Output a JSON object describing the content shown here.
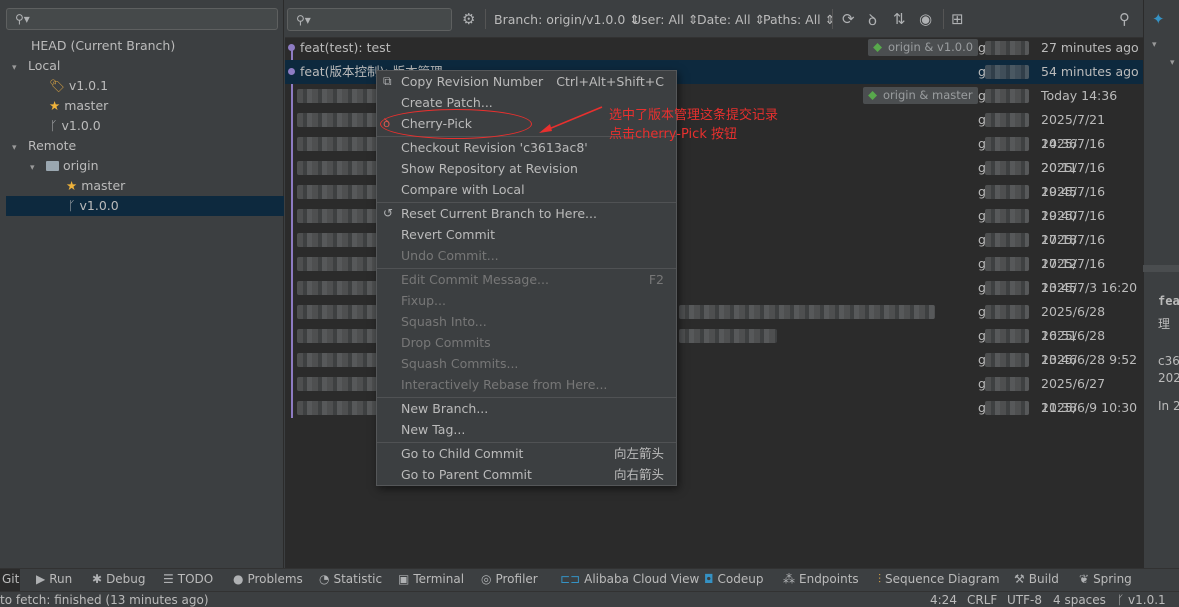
{
  "left": {
    "tree": [
      {
        "label": "HEAD (Current Branch)"
      },
      {
        "label": "Local"
      },
      {
        "label": "v1.0.1"
      },
      {
        "label": "master"
      },
      {
        "label": "v1.0.0"
      },
      {
        "label": "Remote"
      },
      {
        "label": "origin"
      },
      {
        "label": "master"
      },
      {
        "label": "v1.0.0"
      }
    ]
  },
  "toolbar": {
    "branch_filter": "Branch: origin/v1.0.0",
    "user_filter": "User: All",
    "date_filter": "Date: All",
    "paths_filter": "Paths: All"
  },
  "log": {
    "rows": [
      {
        "subject": "feat(test): test",
        "refs": "origin & v1.0.0",
        "author": "g",
        "date": "27 minutes ago"
      },
      {
        "subject": "feat(版本控制): 版本管理",
        "refs": "",
        "author": "g",
        "date": "54 minutes ago"
      },
      {
        "subject": "",
        "refs": "origin & master",
        "author": "g",
        "date": "Today 14:36"
      },
      {
        "subject": "",
        "refs": "",
        "author": "g",
        "date": "2025/7/21 14:36"
      },
      {
        "subject": "",
        "refs": "",
        "author": "g",
        "date": "2025/7/16 20:11"
      },
      {
        "subject": "",
        "refs": "",
        "author": "g",
        "date": "2025/7/16 19:45"
      },
      {
        "subject": "",
        "refs": "",
        "author": "g",
        "date": "2025/7/16 19:40"
      },
      {
        "subject": "",
        "refs": "",
        "author": "g",
        "date": "2025/7/16 17:18"
      },
      {
        "subject": "",
        "refs": "",
        "author": "g",
        "date": "2025/7/16 17:12"
      },
      {
        "subject": "",
        "refs": "",
        "author": "g",
        "date": "2025/7/16 13:45"
      },
      {
        "subject": "",
        "refs": "",
        "author": "g",
        "date": "2025/7/3 16:20"
      },
      {
        "subject": "",
        "refs": "",
        "author": "g",
        "date": "2025/6/28 16:51"
      },
      {
        "subject": "",
        "refs": "",
        "author": "g",
        "date": "2025/6/28 13:46"
      },
      {
        "subject": "",
        "refs": "",
        "author": "g",
        "date": "2025/6/28 9:52"
      },
      {
        "subject": "",
        "refs": "",
        "author": "g",
        "date": "2025/6/27 11:38"
      },
      {
        "subject": "",
        "refs": "",
        "author": "g",
        "date": "2025/6/9 10:30"
      }
    ]
  },
  "details": {
    "lines": [
      "feat",
      "理",
      "c36",
      "202",
      "In 2"
    ]
  },
  "context_menu": {
    "items": [
      {
        "label": "Copy Revision Number",
        "shortcut": "Ctrl+Alt+Shift+C",
        "icon": "copy-icon"
      },
      {
        "label": "Create Patch...",
        "shortcut": "",
        "icon": ""
      },
      {
        "label": "Cherry-Pick",
        "shortcut": "",
        "icon": "cherry-icon"
      },
      {
        "label": "Checkout Revision 'c3613ac8'",
        "shortcut": "",
        "icon": ""
      },
      {
        "label": "Show Repository at Revision",
        "shortcut": "",
        "icon": ""
      },
      {
        "label": "Compare with Local",
        "shortcut": "",
        "icon": ""
      },
      {
        "label": "Reset Current Branch to Here...",
        "shortcut": "",
        "icon": "reset-icon"
      },
      {
        "label": "Revert Commit",
        "shortcut": "",
        "icon": ""
      },
      {
        "label": "Undo Commit...",
        "shortcut": "",
        "icon": "",
        "disabled": true
      },
      {
        "label": "Edit Commit Message...",
        "shortcut": "F2",
        "icon": "",
        "disabled": true
      },
      {
        "label": "Fixup...",
        "shortcut": "",
        "icon": "",
        "disabled": true
      },
      {
        "label": "Squash Into...",
        "shortcut": "",
        "icon": "",
        "disabled": true
      },
      {
        "label": "Drop Commits",
        "shortcut": "",
        "icon": "",
        "disabled": true
      },
      {
        "label": "Squash Commits...",
        "shortcut": "",
        "icon": "",
        "disabled": true
      },
      {
        "label": "Interactively Rebase from Here...",
        "shortcut": "",
        "icon": "",
        "disabled": true
      },
      {
        "label": "New Branch...",
        "shortcut": "",
        "icon": ""
      },
      {
        "label": "New Tag...",
        "shortcut": "",
        "icon": ""
      },
      {
        "label": "Go to Child Commit",
        "shortcut": "向左箭头",
        "icon": ""
      },
      {
        "label": "Go to Parent Commit",
        "shortcut": "向右箭头",
        "icon": ""
      }
    ]
  },
  "annotation": {
    "line1": "选中了版本管理这条提交记录",
    "line2": "点击cherry-Pick 按钮",
    "color": "#e8302e"
  },
  "tool_windows": [
    {
      "label": "Git",
      "icon": ""
    },
    {
      "label": "Run",
      "icon": "run-icon"
    },
    {
      "label": "Debug",
      "icon": "debug-icon"
    },
    {
      "label": "TODO",
      "icon": "todo-icon"
    },
    {
      "label": "Problems",
      "icon": "problems-icon"
    },
    {
      "label": "Statistic",
      "icon": "statistic-icon"
    },
    {
      "label": "Terminal",
      "icon": "terminal-icon"
    },
    {
      "label": "Profiler",
      "icon": "profiler-icon"
    },
    {
      "label": "Alibaba Cloud View",
      "icon": "alibaba-cloud-icon"
    },
    {
      "label": "Codeup",
      "icon": "codeup-icon"
    },
    {
      "label": "Endpoints",
      "icon": "endpoints-icon"
    },
    {
      "label": "Sequence Diagram",
      "icon": "sequence-diagram-icon"
    },
    {
      "label": "Build",
      "icon": "build-icon"
    },
    {
      "label": "Spring",
      "icon": "spring-icon"
    }
  ],
  "status": {
    "message": "to fetch: finished (13 minutes ago)",
    "position": "4:24",
    "line_ending": "CRLF",
    "encoding": "UTF-8",
    "indent": "4 spaces",
    "branch": "v1.0.1"
  }
}
